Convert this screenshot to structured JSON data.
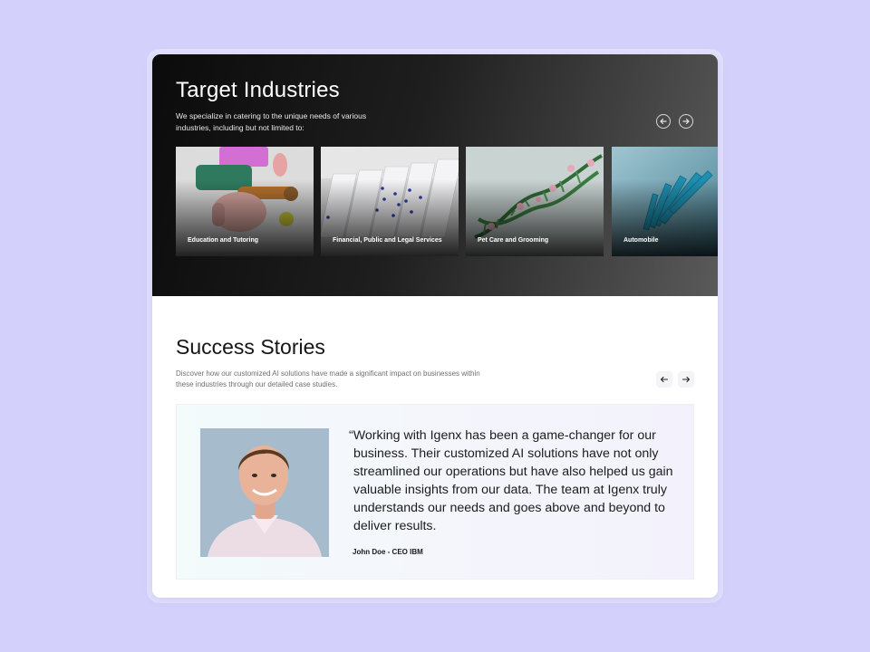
{
  "industries": {
    "title": "Target Industries",
    "description": "We specialize in catering to the unique needs of various industries, including but not limited to:",
    "prev_icon": "arrow-left-circle-icon",
    "next_icon": "arrow-right-circle-icon",
    "items": [
      {
        "label": "Education and Tutoring"
      },
      {
        "label": "Financial, Public and Legal Services"
      },
      {
        "label": "Pet Care and Grooming"
      },
      {
        "label": "Automobile"
      }
    ]
  },
  "stories": {
    "title": "Success Stories",
    "description": "Discover how our customized AI solutions have made a significant impact on businesses within these industries through our detailed case studies.",
    "prev_icon": "arrow-left-icon",
    "next_icon": "arrow-right-icon",
    "testimonial": {
      "quote": "“Working with Igenx has been a game-changer for our business. Their customized AI solutions have not only streamlined our operations but have also helped us gain valuable insights from our data. The team at Igenx truly understands our needs and goes above and beyond to deliver results.",
      "author": "John Doe - CEO IBM"
    }
  },
  "colors": {
    "page_background": "#d3d1fb",
    "dark_section": "#111111",
    "card_background": "#ffffff"
  }
}
